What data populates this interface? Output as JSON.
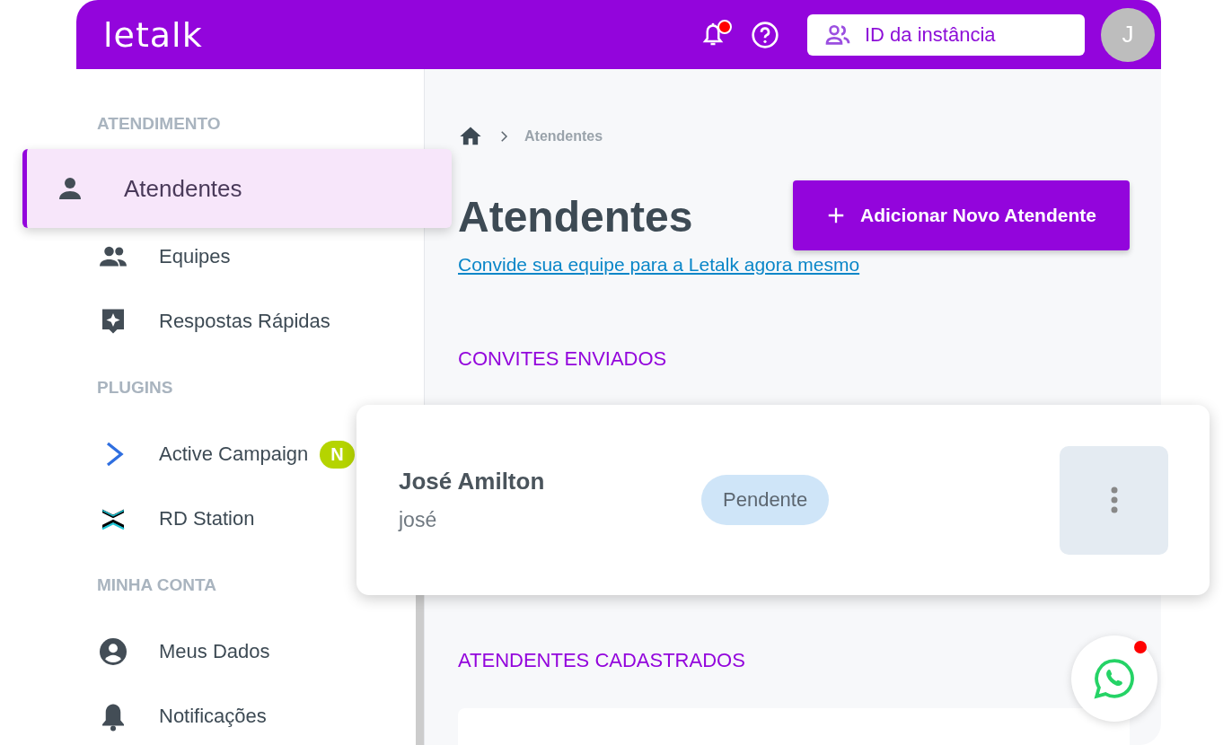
{
  "header": {
    "logo": "letalk",
    "notifications": {
      "unread": true
    },
    "instance_button": "ID da instância",
    "avatar": "J"
  },
  "sidebar": {
    "sections": [
      {
        "title": "ATENDIMENTO",
        "items": [
          {
            "kind": "person",
            "label": "Atendentes",
            "selected": true
          },
          {
            "kind": "group",
            "label": "Equipes",
            "selected": false
          },
          {
            "kind": "quick",
            "label": "Respostas Rápidas",
            "selected": false
          }
        ]
      },
      {
        "title": "PLUGINS",
        "items": [
          {
            "kind": "activecampaign",
            "label": "Active Campaign",
            "badge": "N",
            "selected": false
          },
          {
            "kind": "rdstation",
            "label": "RD Station",
            "selected": false
          }
        ]
      },
      {
        "title": "MINHA CONTA",
        "items": [
          {
            "kind": "account",
            "label": "Meus Dados",
            "selected": false
          },
          {
            "kind": "bell",
            "label": "Notificações",
            "selected": false
          }
        ]
      }
    ]
  },
  "main": {
    "breadcrumb": [
      "Atendentes"
    ],
    "title": "Atendentes",
    "add_button": "Adicionar Novo Atendente",
    "invite_link": "Convide sua equipe para a Letalk agora mesmo",
    "invites_title": "CONVITES ENVIADOS",
    "invites": [
      {
        "name": "José Amilton",
        "username": "josé",
        "status": "Pendente"
      }
    ],
    "registered_title": "ATENDENTES CADASTRADOS"
  },
  "whatsapp": {
    "unread": true
  }
}
